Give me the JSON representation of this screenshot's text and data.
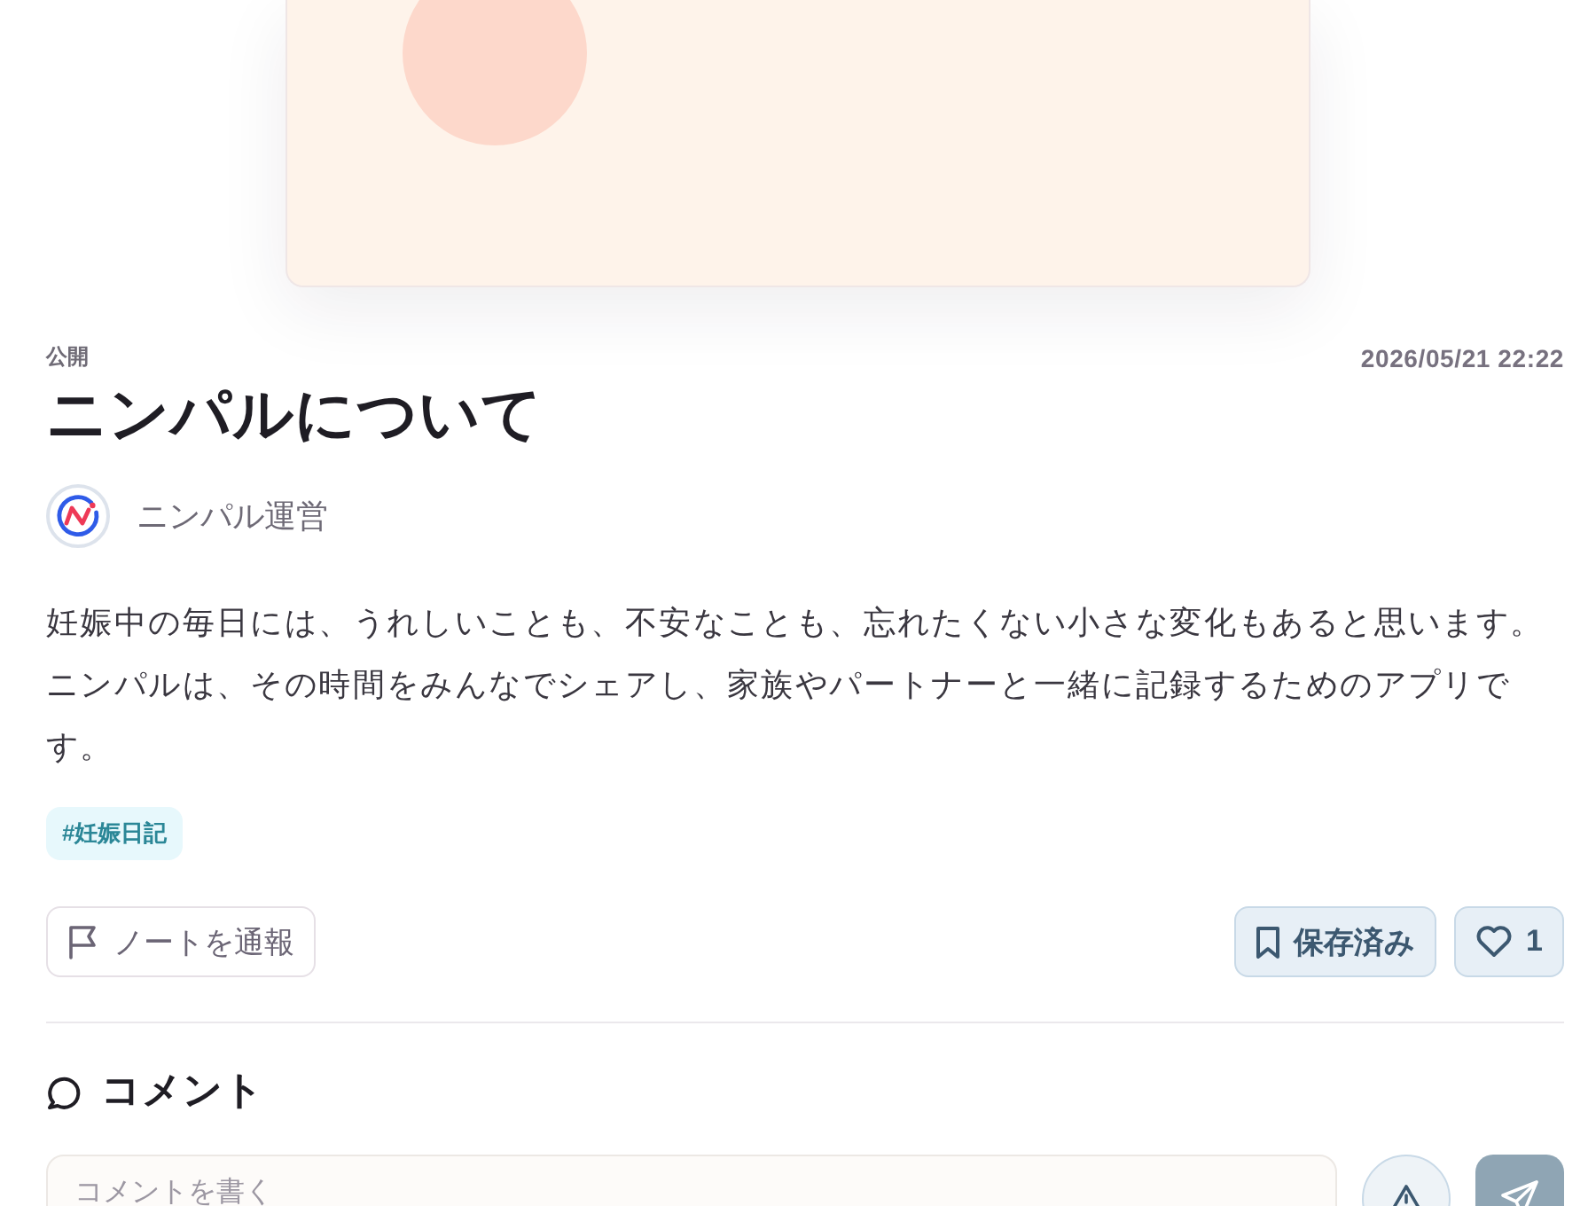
{
  "post": {
    "visibility": "公開",
    "date": "2026/05/21 22:22",
    "title": "ニンパルについて",
    "author": {
      "name": "ニンパル運営"
    },
    "body": "妊娠中の毎日には、うれしいことも、不安なことも、忘れたくない小さな変化もあると思います。ニンパルは、その時間をみんなでシェアし、家族やパートナーと一緒に記録するためのアプリです。",
    "tags": [
      "#妊娠日記"
    ]
  },
  "actions": {
    "report": {
      "label": "ノートを通報"
    },
    "save": {
      "label": "保存済み",
      "selected": true
    },
    "like": {
      "count": "1",
      "selected": true
    }
  },
  "comments": {
    "title": "コメント",
    "input": {
      "placeholder": "コメントを書く"
    },
    "send": {
      "disabled": true
    }
  }
}
